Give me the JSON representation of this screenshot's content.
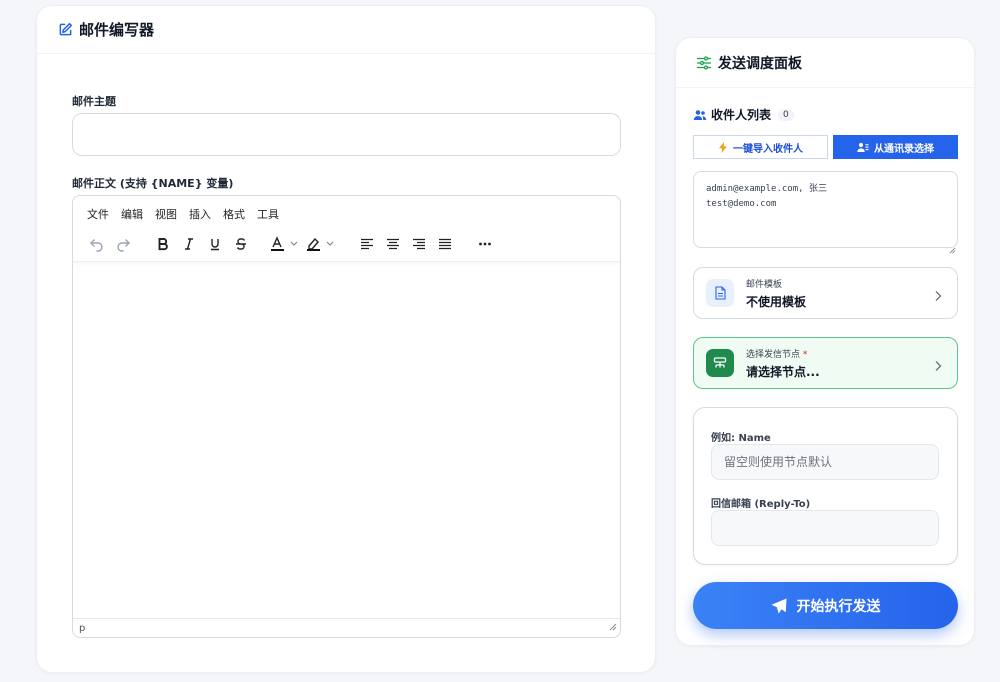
{
  "editor": {
    "title": "邮件编写器",
    "subject_label": "邮件主题",
    "subject_value": "",
    "body_label": "邮件正文 (支持 {NAME} 变量)",
    "menu": [
      "文件",
      "编辑",
      "视图",
      "插入",
      "格式",
      "工具"
    ],
    "status_path": "p"
  },
  "panel": {
    "title": "发送调度面板",
    "recipients_label": "收件人列表",
    "recipients_count": "0",
    "import_button": "一键导入收件人",
    "contacts_button": "从通讯录选择",
    "recipients_text": "admin@example.com, 张三\ntest@demo.com",
    "template": {
      "label": "邮件模板",
      "value": "不使用模板"
    },
    "node": {
      "label": "选择发信节点",
      "required_mark": "*",
      "value": "请选择节点..."
    },
    "sender_name_label": "例如: Name",
    "sender_name_placeholder": "留空则使用节点默认",
    "reply_to_label": "回信邮箱 (Reply-To)",
    "reply_to_value": "",
    "send_button": "开始执行发送"
  },
  "colors": {
    "accent": "#2563eb",
    "success": "#1e8a4c",
    "danger": "#dc2626"
  },
  "icons": [
    "edit-icon",
    "sliders-icon",
    "users-icon",
    "lightning-icon",
    "contacts-icon",
    "file-icon",
    "server-icon",
    "chevron-right-icon",
    "send-icon"
  ]
}
